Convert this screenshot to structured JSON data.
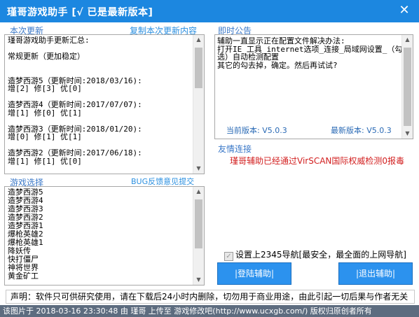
{
  "window": {
    "title": "瑾哥游戏助手 [√ 已是最新版本]",
    "close_glyph": "✕"
  },
  "update_section": {
    "label": "本次更新",
    "copy_link": "复制本次更新内容",
    "lines": [
      "瑾哥游戏助手更新汇总:",
      "",
      "常规更新（更加稳定）",
      "",
      "",
      "造梦西游5（更新时间:2018/03/16):",
      "增[2] 修[3] 优[0]",
      "",
      "造梦西游4（更新时间:2017/07/07):",
      "增[1] 修[0] 优[1]",
      "",
      "造梦西游3（更新时间:2018/01/20):",
      "增[0] 修[1] 优[1]",
      "",
      "造梦西游2（更新时间:2017/06/18):",
      "增[1] 修[1] 优[0]"
    ]
  },
  "game_section": {
    "label": "游戏选择",
    "bug_link": "BUG反馈意见提交",
    "games": [
      "造梦西游5",
      "造梦西游4",
      "造梦西游3",
      "造梦西游2",
      "造梦西游1",
      "爆枪英雄2",
      "爆枪英雄1",
      "降妖传",
      "快打僵尸",
      "神将世界",
      "黄金矿工"
    ]
  },
  "notice_section": {
    "label": "即时公告",
    "lines": [
      "辅助一直显示正在配置文件解决办法:",
      "打开IE_工具_internet选项_连接_局域网设置_（勾",
      "选）自动检测配置",
      "其它的勾去掉，确定。然后再试试?"
    ],
    "current_version": "当前版本: V5.0.3",
    "latest_version": "最新版本: V5.0.3"
  },
  "friend_section": {
    "label": "友情连接",
    "virscan_text": "瑾哥辅助已经通过VirSCAN国际权威检测0报毒"
  },
  "options": {
    "set_homepage": "设置上2345导航[最安全，最全面的上网导航]",
    "set_homepage_checked": true
  },
  "buttons": {
    "login": "|登陆辅助|",
    "exit": "|退出辅助|"
  },
  "footer": {
    "disclaimer": "声明：软件只可供研究使用，请在下载后24小时内删除，切勿用于商业用途，由此引起一切后果与作者无关"
  },
  "watermark": {
    "text": "该图片于 2018-03-16 23:30:48 由 瑾哥 上传至 游戏修改吧(http://www.ucxgb.com/) 版权归原创者所有"
  },
  "colors": {
    "titlebar": "#1c87e0",
    "accent_link": "#2a8fe0",
    "red_text": "#d21f1f",
    "button": "#2c92ee"
  }
}
